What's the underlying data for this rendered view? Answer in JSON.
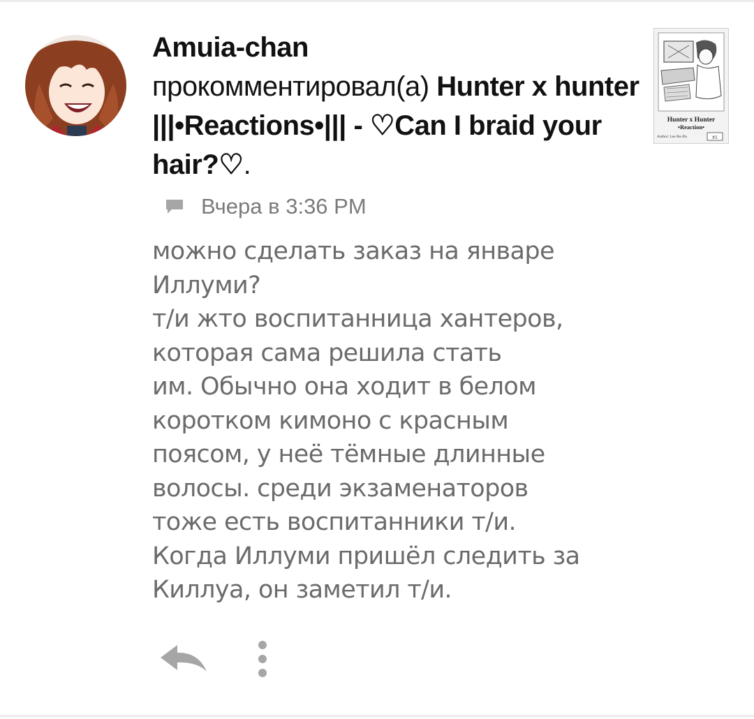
{
  "comment": {
    "username": "Amuia-chan",
    "action": "прокомментировал(а)",
    "post_title": "Hunter x hunter |||•Reactions•||| - ♡Can I braid your hair?♡",
    "period": ".",
    "timestamp": "Вчера в 3:36 PM",
    "body": "можно сделать заказ на январе\nИллуми?\nт/и жто воспитанница хантеров,\nкоторая сама решила стать\nим. Обычно она ходит в белом\nкоротком кимоно с красным\nпоясом, у неё тёмные длинные\nволосы. среди экзаменаторов\nтоже есть воспитанники т/и.\nКогда Иллуми пришёл следить за\nКиллуа, он заметил т/и."
  },
  "thumbnail": {
    "title_line1": "Hunter x Hunter",
    "title_line2": "•Reaction•",
    "author": "Author: Lee Ru-Da",
    "number": "#1"
  },
  "icons": {
    "timestamp": "comment-icon",
    "reply": "reply-arrow-icon",
    "more": "more-vertical-icon"
  },
  "colors": {
    "text_primary": "#111111",
    "text_secondary": "#6b6b6b",
    "meta": "#7a7a7a",
    "icon": "#a6a6a6"
  }
}
